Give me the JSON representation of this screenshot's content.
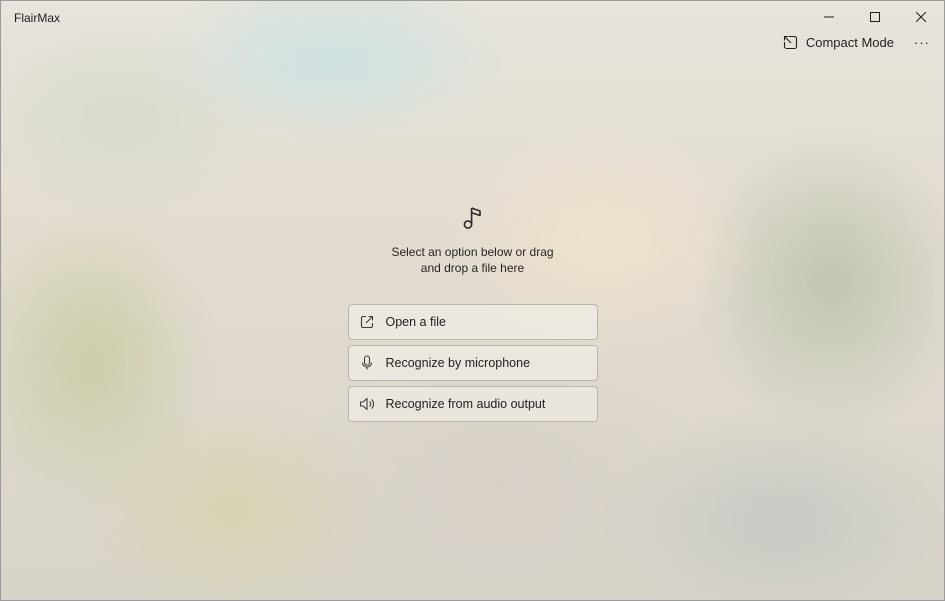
{
  "window": {
    "title": "FlairMax"
  },
  "title_bar": {
    "controls": [
      "minimize",
      "maximize",
      "close"
    ]
  },
  "toolbar": {
    "compact_mode_label": "Compact Mode",
    "more_label": "···"
  },
  "main": {
    "icon": "music-note-icon",
    "prompt_line1": "Select an option below or drag",
    "prompt_line2": "and drop a file here",
    "options": [
      {
        "label": "Open a file",
        "icon": "open-external-icon"
      },
      {
        "label": "Recognize by microphone",
        "icon": "microphone-icon"
      },
      {
        "label": "Recognize from audio output",
        "icon": "speaker-icon"
      }
    ]
  },
  "colors": {
    "button_border": "#b9b6ae",
    "text": "#1f1f1f"
  }
}
